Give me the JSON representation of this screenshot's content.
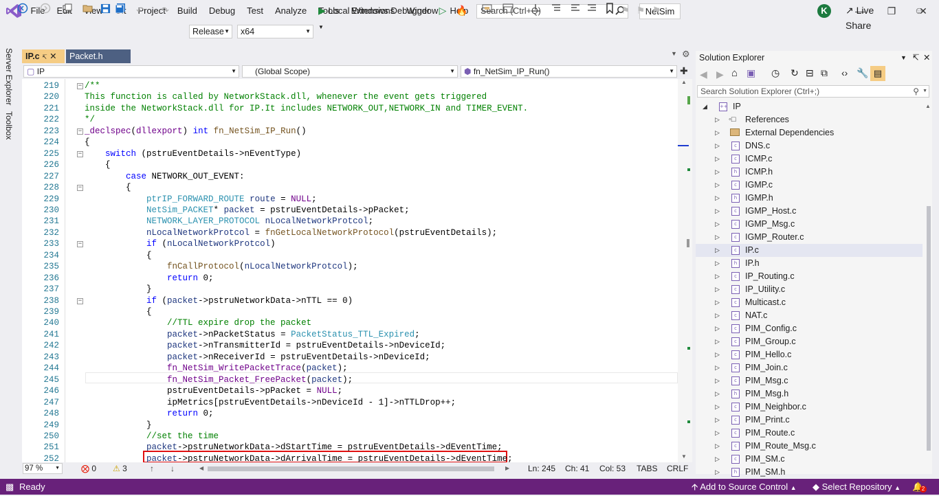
{
  "menu": [
    "File",
    "Edit",
    "View",
    "Git",
    "Project",
    "Build",
    "Debug",
    "Test",
    "Analyze",
    "Tools",
    "Extensions",
    "Window",
    "Help"
  ],
  "search": {
    "placeholder": "Search (Ctrl+Q)"
  },
  "solution_name": "NetSim",
  "user_initial": "K",
  "toolbar": {
    "config": "Release",
    "platform": "x64",
    "debugger": "Local Windows Debugger",
    "live_share": "Live Share"
  },
  "side_tabs": [
    "Server Explorer",
    "Toolbox"
  ],
  "doc_tabs": [
    {
      "label": "IP.c",
      "active": true
    },
    {
      "label": "Packet.h",
      "active": false
    }
  ],
  "nav": {
    "project": "IP",
    "scope": "(Global Scope)",
    "function": "fn_NetSim_IP_Run()"
  },
  "code_lines": [
    {
      "num": "219",
      "fold": "−",
      "segs": [
        [
          "c",
          "/**"
        ]
      ]
    },
    {
      "num": "220",
      "fold": "",
      "segs": [
        [
          "c",
          "This function is called by NetworkStack.dll, whenever the event gets triggered"
        ]
      ]
    },
    {
      "num": "221",
      "fold": "",
      "segs": [
        [
          "c",
          "inside the NetworkStack.dll for IP.It includes NETWORK_OUT,NETWORK_IN and TIMER_EVENT."
        ]
      ]
    },
    {
      "num": "222",
      "fold": "",
      "segs": [
        [
          "c",
          "*/"
        ]
      ]
    },
    {
      "num": "223",
      "fold": "−",
      "segs": [
        [
          "m",
          "_declspec"
        ],
        [
          "g",
          "("
        ],
        [
          "m",
          "dllexport"
        ],
        [
          "g",
          ") "
        ],
        [
          "k",
          "int"
        ],
        [
          "g",
          " "
        ],
        [
          "f",
          "fn_NetSim_IP_Run"
        ],
        [
          "g",
          "()"
        ]
      ]
    },
    {
      "num": "224",
      "fold": "",
      "segs": [
        [
          "g",
          "{"
        ]
      ]
    },
    {
      "num": "225",
      "fold": "−",
      "segs": [
        [
          "g",
          "    "
        ],
        [
          "k",
          "switch"
        ],
        [
          "g",
          " (pstruEventDetails->nEventType)"
        ]
      ]
    },
    {
      "num": "226",
      "fold": "",
      "segs": [
        [
          "g",
          "    {"
        ]
      ]
    },
    {
      "num": "227",
      "fold": "",
      "segs": [
        [
          "g",
          "        "
        ],
        [
          "k",
          "case"
        ],
        [
          "g",
          " NETWORK_OUT_EVENT:"
        ]
      ]
    },
    {
      "num": "228",
      "fold": "−",
      "segs": [
        [
          "g",
          "        {"
        ]
      ]
    },
    {
      "num": "229",
      "fold": "",
      "segs": [
        [
          "g",
          "            "
        ],
        [
          "t",
          "ptrIP_FORWARD_ROUTE"
        ],
        [
          "g",
          " "
        ],
        [
          "v",
          "route"
        ],
        [
          "g",
          " = "
        ],
        [
          "m",
          "NULL"
        ],
        [
          "g",
          ";"
        ]
      ]
    },
    {
      "num": "230",
      "fold": "",
      "segs": [
        [
          "g",
          "            "
        ],
        [
          "t",
          "NetSim_PACKET"
        ],
        [
          "g",
          "* "
        ],
        [
          "v",
          "packet"
        ],
        [
          "g",
          " = pstruEventDetails->pPacket;"
        ]
      ]
    },
    {
      "num": "231",
      "fold": "",
      "segs": [
        [
          "g",
          "            "
        ],
        [
          "t",
          "NETWORK_LAYER_PROTOCOL"
        ],
        [
          "g",
          " "
        ],
        [
          "v",
          "nLocalNetworkProtcol"
        ],
        [
          "g",
          ";"
        ]
      ]
    },
    {
      "num": "232",
      "fold": "",
      "segs": [
        [
          "g",
          "            "
        ],
        [
          "v",
          "nLocalNetworkProtcol"
        ],
        [
          "g",
          " = "
        ],
        [
          "f",
          "fnGetLocalNetworkProtocol"
        ],
        [
          "g",
          "(pstruEventDetails);"
        ]
      ]
    },
    {
      "num": "233",
      "fold": "−",
      "segs": [
        [
          "g",
          "            "
        ],
        [
          "k",
          "if"
        ],
        [
          "g",
          " ("
        ],
        [
          "v",
          "nLocalNetworkProtcol"
        ],
        [
          "g",
          ")"
        ]
      ]
    },
    {
      "num": "234",
      "fold": "",
      "segs": [
        [
          "g",
          "            {"
        ]
      ]
    },
    {
      "num": "235",
      "fold": "",
      "segs": [
        [
          "g",
          "                "
        ],
        [
          "f",
          "fnCallProtocol"
        ],
        [
          "g",
          "("
        ],
        [
          "v",
          "nLocalNetworkProtcol"
        ],
        [
          "g",
          ");"
        ]
      ]
    },
    {
      "num": "236",
      "fold": "",
      "segs": [
        [
          "g",
          "                "
        ],
        [
          "k",
          "return"
        ],
        [
          "g",
          " 0;"
        ]
      ]
    },
    {
      "num": "237",
      "fold": "",
      "segs": [
        [
          "g",
          "            }"
        ]
      ]
    },
    {
      "num": "238",
      "fold": "−",
      "segs": [
        [
          "g",
          "            "
        ],
        [
          "k",
          "if"
        ],
        [
          "g",
          " ("
        ],
        [
          "v",
          "packet"
        ],
        [
          "g",
          "->pstruNetworkData->nTTL == 0)"
        ]
      ]
    },
    {
      "num": "239",
      "fold": "",
      "segs": [
        [
          "g",
          "            {"
        ]
      ]
    },
    {
      "num": "240",
      "fold": "",
      "segs": [
        [
          "g",
          "                "
        ],
        [
          "c",
          "//TTL expire drop the packet"
        ]
      ]
    },
    {
      "num": "241",
      "fold": "",
      "segs": [
        [
          "g",
          "                "
        ],
        [
          "v",
          "packet"
        ],
        [
          "g",
          "->nPacketStatus = "
        ],
        [
          "t",
          "PacketStatus_TTL_Expired"
        ],
        [
          "g",
          ";"
        ]
      ]
    },
    {
      "num": "242",
      "fold": "",
      "segs": [
        [
          "g",
          "                "
        ],
        [
          "v",
          "packet"
        ],
        [
          "g",
          "->nTransmitterId = pstruEventDetails->nDeviceId;"
        ]
      ]
    },
    {
      "num": "243",
      "fold": "",
      "segs": [
        [
          "g",
          "                "
        ],
        [
          "v",
          "packet"
        ],
        [
          "g",
          "->nReceiverId = pstruEventDetails->nDeviceId;"
        ]
      ]
    },
    {
      "num": "244",
      "fold": "",
      "segs": [
        [
          "g",
          "                "
        ],
        [
          "m",
          "fn_NetSim_WritePacketTrace"
        ],
        [
          "g",
          "("
        ],
        [
          "v",
          "packet"
        ],
        [
          "g",
          ");"
        ]
      ]
    },
    {
      "num": "245",
      "fold": "",
      "segs": [
        [
          "g",
          "                "
        ],
        [
          "m",
          "fn_NetSim_Packet_FreePacket"
        ],
        [
          "g",
          "("
        ],
        [
          "v",
          "packet"
        ],
        [
          "g",
          ");"
        ]
      ]
    },
    {
      "num": "246",
      "fold": "",
      "segs": [
        [
          "g",
          "                pstruEventDetails->pPacket = "
        ],
        [
          "m",
          "NULL"
        ],
        [
          "g",
          ";"
        ]
      ]
    },
    {
      "num": "247",
      "fold": "",
      "segs": [
        [
          "g",
          "                ipMetrics[pstruEventDetails->nDeviceId - 1]->nTTLDrop++;"
        ]
      ]
    },
    {
      "num": "248",
      "fold": "",
      "segs": [
        [
          "g",
          "                "
        ],
        [
          "k",
          "return"
        ],
        [
          "g",
          " 0;"
        ]
      ]
    },
    {
      "num": "249",
      "fold": "",
      "segs": [
        [
          "g",
          "            }"
        ]
      ]
    },
    {
      "num": "250",
      "fold": "",
      "segs": [
        [
          "g",
          "            "
        ],
        [
          "c",
          "//set the time"
        ]
      ]
    },
    {
      "num": "251",
      "fold": "",
      "segs": [
        [
          "g",
          "            "
        ],
        [
          "v",
          "packet"
        ],
        [
          "g",
          "->pstruNetworkData->dStartTime = pstruEventDetails->dEventTime;"
        ]
      ]
    },
    {
      "num": "252",
      "fold": "",
      "segs": [
        [
          "g",
          "            "
        ],
        [
          "v",
          "packet"
        ],
        [
          "g",
          "->pstruNetworkData->dArrivalTime = pstruEventDetails->dEventTime;"
        ]
      ]
    }
  ],
  "editor_status": {
    "zoom": "97 %",
    "errors": "0",
    "warnings": "3",
    "ln": "Ln: 245",
    "ch": "Ch: 41",
    "col": "Col: 53",
    "tabs": "TABS",
    "eol": "CRLF"
  },
  "solution_explorer": {
    "title": "Solution Explorer",
    "search_placeholder": "Search Solution Explorer (Ctrl+;)",
    "root": "IP",
    "items": [
      "References",
      "External Dependencies",
      "DNS.c",
      "ICMP.c",
      "ICMP.h",
      "IGMP.c",
      "IGMP.h",
      "IGMP_Host.c",
      "IGMP_Msg.c",
      "IGMP_Router.c",
      "IP.c",
      "IP.h",
      "IP_Routing.c",
      "IP_Utility.c",
      "Multicast.c",
      "NAT.c",
      "PIM_Config.c",
      "PIM_Group.c",
      "PIM_Hello.c",
      "PIM_Join.c",
      "PIM_Msg.c",
      "PIM_Msg.h",
      "PIM_Neighbor.c",
      "PIM_Print.c",
      "PIM_Route.c",
      "PIM_Route_Msg.c",
      "PIM_SM.c",
      "PIM_SM.h"
    ],
    "selected": "IP.c"
  },
  "statusbar": {
    "ready": "Ready",
    "source_control": "Add to Source Control",
    "repo": "Select Repository",
    "notifications": "2"
  }
}
